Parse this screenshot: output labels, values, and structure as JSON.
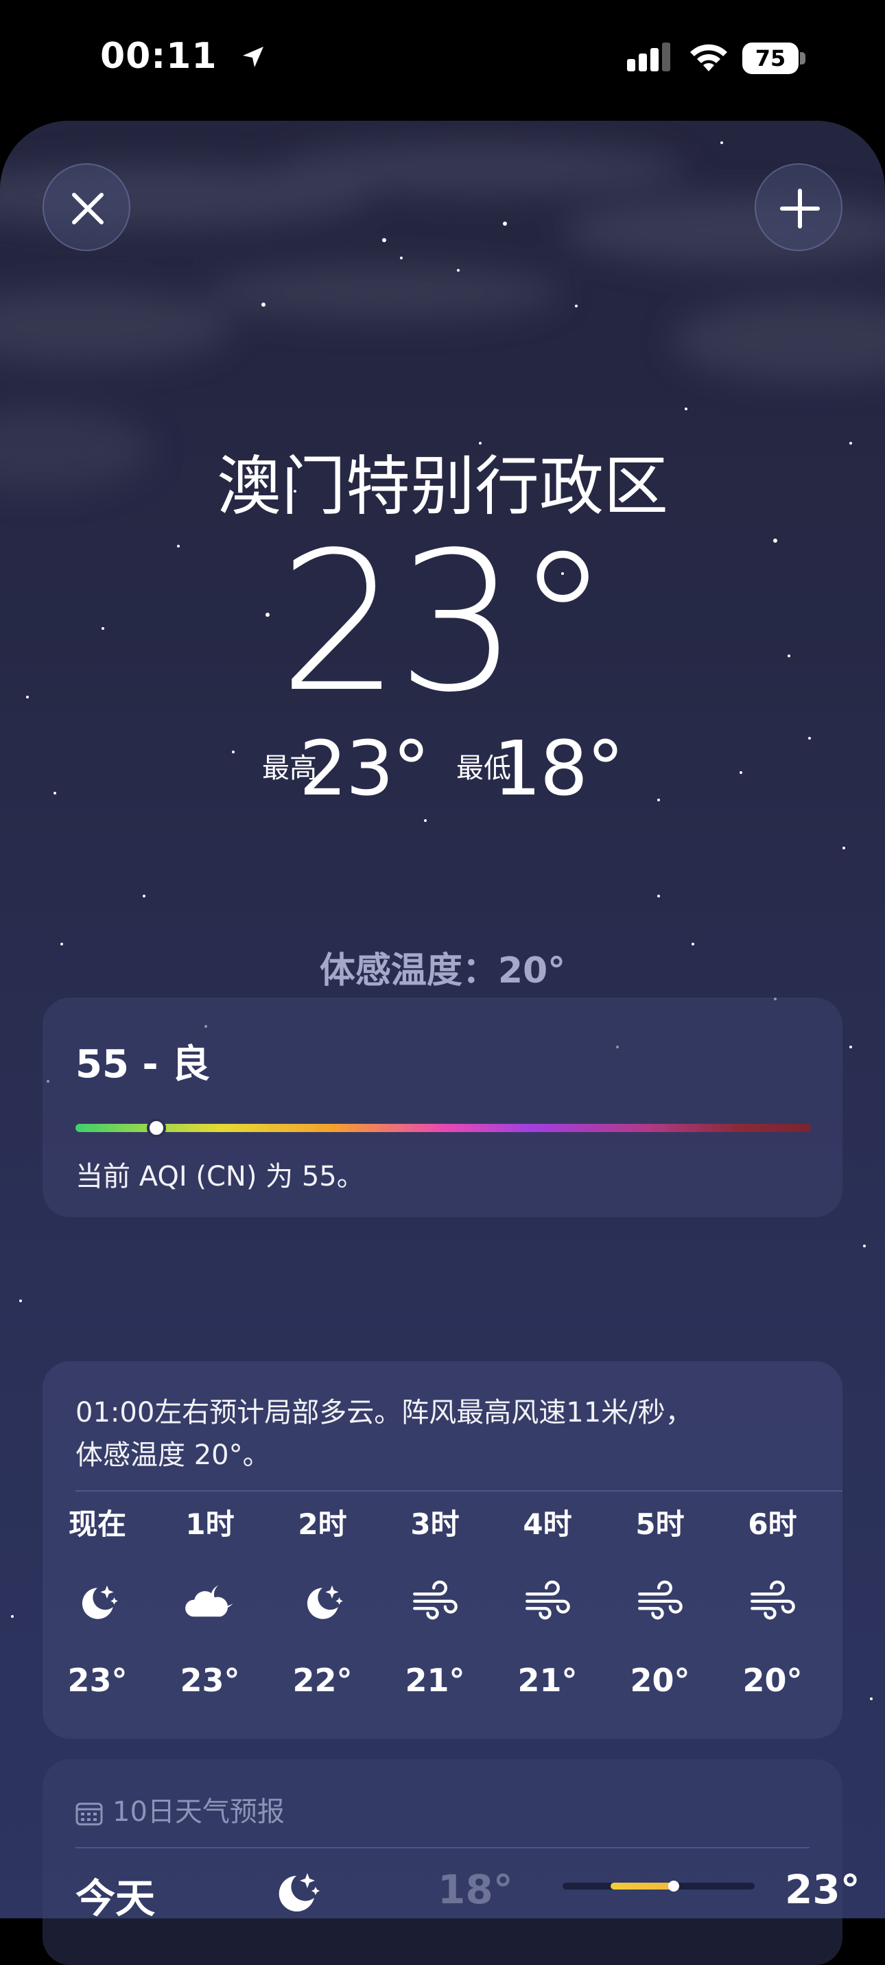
{
  "status_bar": {
    "time": "00:11",
    "battery": "75"
  },
  "location": {
    "city": "澳门特别行政区",
    "current_temp": "23°",
    "high_label": "最高",
    "high_value": "23°",
    "low_label": "最低",
    "low_value": "18°",
    "feels_like": "体感温度：20°"
  },
  "aqi": {
    "title": "55 - 良",
    "value": 55,
    "marker_fraction": 0.11,
    "description": "当前 AQI (CN) 为 55。"
  },
  "hourly": {
    "summary_line1": "01:00左右预计局部多云。阵风最高风速11米/秒，",
    "summary_line2": "体感温度 20°。",
    "items": [
      {
        "time": "现在",
        "icon": "moon-stars-icon",
        "temp": "23°"
      },
      {
        "time": "1时",
        "icon": "cloud-moon-icon",
        "temp": "23°"
      },
      {
        "time": "2时",
        "icon": "moon-stars-icon",
        "temp": "22°"
      },
      {
        "time": "3时",
        "icon": "wind-icon",
        "temp": "21°"
      },
      {
        "time": "4时",
        "icon": "wind-icon",
        "temp": "21°"
      },
      {
        "time": "5时",
        "icon": "wind-icon",
        "temp": "20°"
      },
      {
        "time": "6时",
        "icon": "wind-icon",
        "temp": "20°"
      }
    ]
  },
  "ten_day": {
    "header": "10日天气预报",
    "days": [
      {
        "day": "今天",
        "icon": "moon-stars-icon",
        "low": "18°",
        "high": "23°",
        "range_start_fraction": 0.25,
        "range_end_fraction": 0.6,
        "current_fraction": 0.58
      }
    ]
  },
  "colors": {
    "sheet_top": "#24253e",
    "sheet_bottom": "#2d3560",
    "feels_like_text": "#a6a8c9",
    "muted_text": "#8f93b8"
  }
}
